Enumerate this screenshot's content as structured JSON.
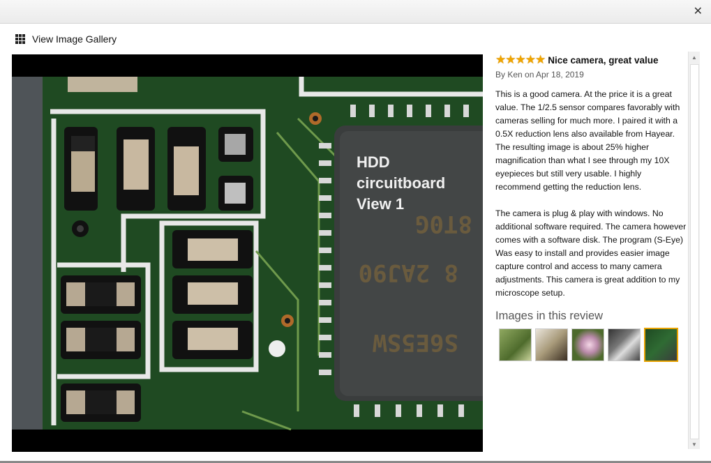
{
  "topbar": {
    "close_icon": "close-icon"
  },
  "gallery": {
    "link_label": "View Image Gallery",
    "icon": "grid-icon"
  },
  "viewer": {
    "overlay_line1": "HDD",
    "overlay_line2": "circuitboard",
    "overlay_line3": "View 1"
  },
  "review": {
    "rating": 5,
    "stars": "★★★★★",
    "title": "Nice camera, great value",
    "byline": "By Ken on Apr 18, 2019",
    "paragraph1": "This is a good camera. At the price it is a great value. The 1/2.5 sensor compares favorably with cameras selling for much more. I paired it with a 0.5X reduction lens also available from Hayear. The resulting image is about 25% higher magnification than what I see through my 10X eyepieces but still very usable. I highly recommend getting the reduction lens.",
    "paragraph2": "The camera is plug & play with windows. No additional software required. The camera however comes with a software disk. The program (S-Eye) Was easy to install and provides easier image capture control and access to many camera adjustments. This camera is great addition to my microscope setup.",
    "images_heading": "Images in this review"
  },
  "colors": {
    "star": "#f0a500",
    "selected_thumb": "#e8a200",
    "pcb_green": "#1f4a22"
  }
}
